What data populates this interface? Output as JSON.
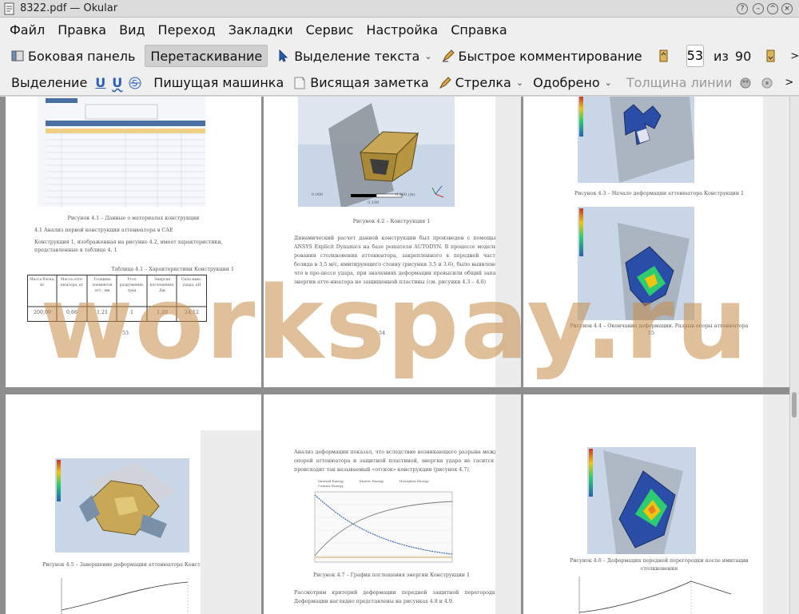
{
  "window": {
    "title": "8322.pdf — Okular"
  },
  "menubar": {
    "items": [
      "Файл",
      "Правка",
      "Вид",
      "Переход",
      "Закладки",
      "Сервис",
      "Настройка",
      "Справка"
    ]
  },
  "toolbar1": {
    "sidebar_label": "Боковая панель",
    "drag_label": "Перетаскивание",
    "text_select_label": "Выделение текста",
    "quick_comment_label": "Быстрое комментирование",
    "page_current": "53",
    "page_of": "из",
    "page_total": "90"
  },
  "toolbar2": {
    "highlight_label": "Выделение",
    "typewriter_label": "Пишущая машинка",
    "sticky_label": "Висящая заметка",
    "arrow_label": "Стрелка",
    "stamp_label": "Одобрено",
    "line_width_label": "Толщина линии"
  },
  "pages": {
    "p1": {
      "caption": "Рисунок 4.1 – Данные о материалах конструкции",
      "section": "4.1 Анализ первой конструкции аттенюатора в САЕ",
      "para": "Конструкция 1, изображенная на рисунке 4.2, имеет характеристики, представленные в таблице 4. 1",
      "table_title": "Таблица 4.1 – Характеристики Конструкции 1",
      "table_headers": [
        "Масса блока, кг",
        "Масса атте-нюатора, кг",
        "Толщина элементов атт., мм",
        "Угол разрушения, град",
        "Энергия поглощения, Дж",
        "Сила макс. удара, кН"
      ],
      "table_row": [
        "200,00",
        "0,66",
        "1,21",
        "1",
        "1,20",
        "24,12"
      ],
      "page_num": "53"
    },
    "p2": {
      "caption": "Рисунок 4.2 – Конструкция 1",
      "para": "Динамический расчет данной конструкции был произведен с помощью ANSYS Explicit Dynamics на базе решателя AUTODYN. В процессе модели-рования столкновения аттенюатора, закрепленного к передней части болида в 3,5 м/с, имитирующего стенку (рисунки 3.5 и 3.6), было выявлено, что в про-цессе удара, при значениях деформации превысили общий запас энергии атте-нюатора не защищенной пластины (см. рисунки 4.3 – 4.6)",
      "scale_left": "0.000",
      "scale_right": "0.200 (m)",
      "scale_mid": "0.100",
      "page_num": "54"
    },
    "p3": {
      "caption_top": "Рисунок 4.3 – Начало деформации аттенюатора Конструкции 1",
      "caption_bottom": "Рисунок 4.4 – Окончание деформации. Разрыв опоры аттенюатора",
      "page_num": "55"
    },
    "p4": {
      "caption": "Рисунок 4.5 – Завершение деформации аттенюатора Конструкции 1"
    },
    "p5": {
      "para": "Анализ деформации показал, что вследствие возникающего разрыва между опорой аттенюатора и защитной пластиной, энергия удара не гасится и происходит так называемый «отскок» конструкции (рисунок 4.7).",
      "legend": [
        "Internal Energy",
        "Kinetic Energy",
        "Hourglass Energy",
        "Contact Energy"
      ],
      "caption": "Рисунок 4.7 – График поглощения энергии Конструкции 1",
      "para2": "Рассмотрим критерий деформации передней защитной перегородки. Деформации наглядно представлены на рисунках 4.8 и 4.9."
    },
    "p6": {
      "caption": "Рисунок 4.6 – Деформация передней перегородки после имитации столкновения"
    }
  },
  "watermark": "workspay.ru",
  "colors": {
    "toolbar_bg": "#efefef",
    "doc_bg": "#8e8e8e",
    "watermark": "#c48c48"
  }
}
